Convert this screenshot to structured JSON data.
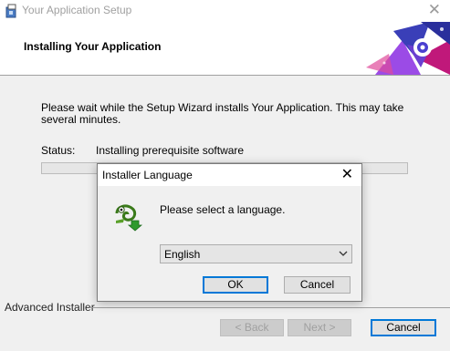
{
  "window": {
    "title": "Your Application Setup",
    "close_glyph": "✕",
    "icons": {
      "app": "installer-app-icon",
      "close": "close-icon"
    }
  },
  "banner": {
    "heading": "Installing Your Application",
    "art_icon": "banner-graphic-icon"
  },
  "main": {
    "description": "Please wait while the Setup Wizard installs Your Application.  This may take several minutes.",
    "status_label": "Status:",
    "status_value": "Installing prerequisite software",
    "progress_fraction": 0
  },
  "footer": {
    "brand": "Advanced Installer",
    "back_label": "< Back",
    "next_label": "Next >",
    "cancel_label": "Cancel"
  },
  "language_dialog": {
    "title": "Installer Language",
    "close_glyph": "✕",
    "prompt": "Please select a language.",
    "selected_language": "English",
    "ok_label": "OK",
    "cancel_label": "Cancel",
    "icons": {
      "main": "installer-chameleon-icon",
      "dropdown": "chevron-down-icon"
    }
  },
  "colors": {
    "accent": "#0078d7",
    "progress_fill": "#06b025"
  }
}
